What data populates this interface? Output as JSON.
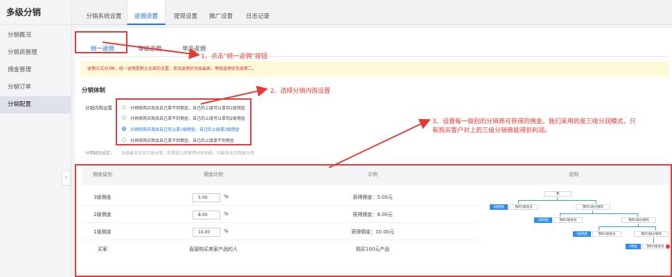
{
  "sidebar": {
    "title": "多级分销",
    "items": [
      {
        "label": "分销概况"
      },
      {
        "label": "分销商管理"
      },
      {
        "label": "佣金管理"
      },
      {
        "label": "分销订单"
      },
      {
        "label": "分销配置"
      }
    ]
  },
  "top_tabs": [
    {
      "label": "分销系统设置"
    },
    {
      "label": "返佣设置"
    },
    {
      "label": "提现设置"
    },
    {
      "label": "推广设置"
    },
    {
      "label": "日志记录"
    }
  ],
  "sub_tabs": [
    {
      "label": "统一返佣"
    },
    {
      "label": "等级返佣"
    },
    {
      "label": "单品返佣"
    }
  ],
  "notice": "返佣方式分3种，统一返佣是默认全部的设置，单品返佣优先级最高，等级返佣优先级第二。",
  "section_title": "分销体制",
  "inner_purchase": {
    "label": "分销内购设置",
    "options": [
      {
        "text": "分销商购买商品自己拿不到佣金，自己的上级可以拿到1级佣金"
      },
      {
        "text": "分销商购买商品自己拿不到佣金，自己的上级可以拿到2级佣金"
      },
      {
        "text": "分销商购买商品自己可以拿1级佣金，自己的上级拿2级佣金"
      },
      {
        "text": "分销商购买商品自己拿不到佣金，自己的上级拿不到佣金"
      }
    ],
    "selected_index": 2
  },
  "level_hint": {
    "label": "分佣级别设定：",
    "text": "系统最多支持三级分佣，若需提上级使用分销功能，则最多支持两级分佣"
  },
  "table": {
    "headers": [
      "佣金级别",
      "佣金比例",
      "示例",
      "说明"
    ],
    "rows": [
      {
        "level": "3级佣金",
        "value": "5.00",
        "unit": "%",
        "example": "获得佣金：5.00元"
      },
      {
        "level": "2级佣金",
        "value": "8.00",
        "unit": "%",
        "example": "获得佣金：8.00元"
      },
      {
        "level": "1级佣金",
        "value": "10.00",
        "unit": "%",
        "example": "获得佣金：10.00元"
      },
      {
        "level": "买家",
        "value": "直接购买商家产品的人",
        "unit": "",
        "example": "购买100元产品"
      }
    ]
  },
  "diagram": {
    "root": "我",
    "n3": "3级佣金",
    "my1": "我的1级会员",
    "d1": "我的1级分销商",
    "n2": "2级佣金",
    "my2": "我的2级会员",
    "d2": "我的2级分销商",
    "n1": "1级佣金",
    "my3": "我的3级会员",
    "d3": "我的3级分销商",
    "buyer_tag": "0佣金",
    "buyer": "我的4级会员"
  },
  "annotations": {
    "a1": "1、点击“统一返佣”按钮",
    "a2": "2、选择分销内购设置",
    "a3_line1": "3、设置每一级别的分销商可获得的佣金。我们采用的是三级分润模式，只",
    "a3_line2": "有购买客户对上的三级分销商能得到利润。"
  },
  "colors": {
    "accent": "#1a73e8",
    "annotation_red": "#e53935",
    "notice_bg": "#fcfad8"
  }
}
